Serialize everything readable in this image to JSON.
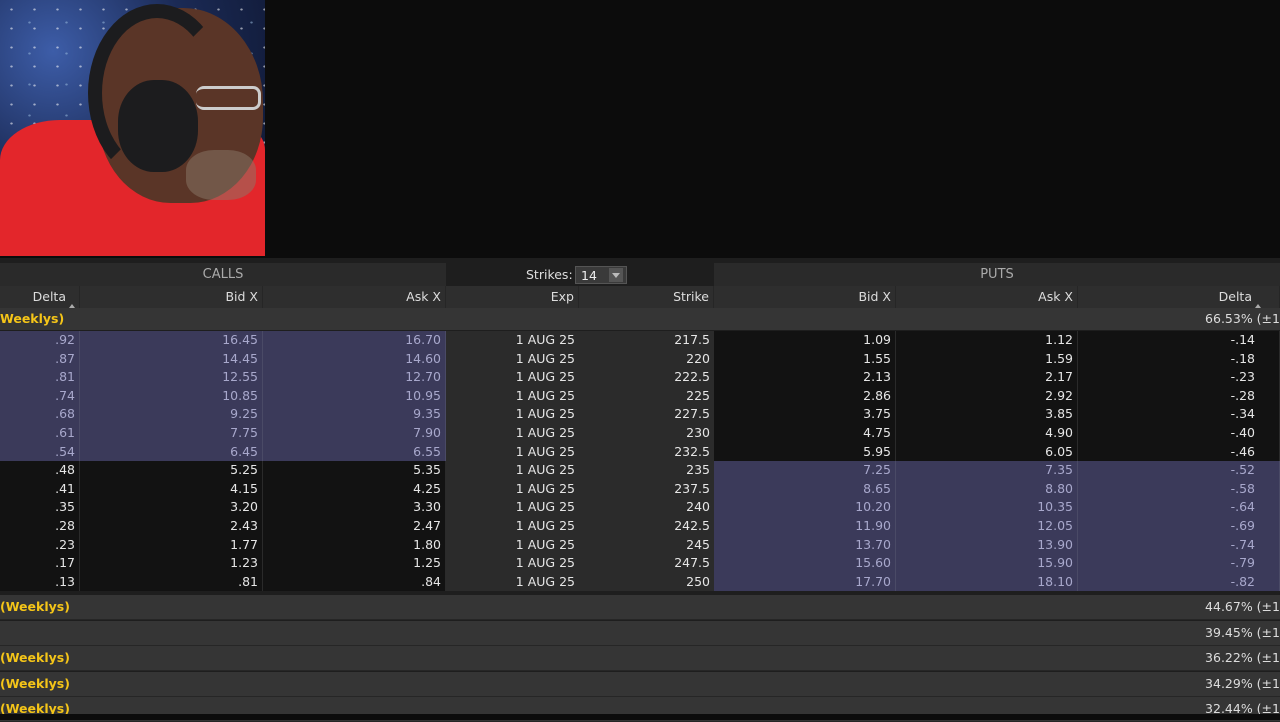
{
  "calls_header": "CALLS",
  "puts_header": "PUTS",
  "strikes_label": "Strikes:",
  "strikes_value": "14",
  "columns": {
    "call_delta": "Delta",
    "call_bid": "Bid X",
    "call_ask": "Ask X",
    "exp": "Exp",
    "strike": "Strike",
    "put_bid": "Bid X",
    "put_ask": "Ask X",
    "put_delta": "Delta"
  },
  "top_group": {
    "name": "Weeklys)",
    "pct": "66.53% (±1"
  },
  "rows": [
    {
      "cd": ".92",
      "cb": "16.45",
      "ca": "16.70",
      "exp": "1 AUG 25",
      "strike": "217.5",
      "pb": "1.09",
      "pa": "1.12",
      "pd": "-.14"
    },
    {
      "cd": ".87",
      "cb": "14.45",
      "ca": "14.60",
      "exp": "1 AUG 25",
      "strike": "220",
      "pb": "1.55",
      "pa": "1.59",
      "pd": "-.18"
    },
    {
      "cd": ".81",
      "cb": "12.55",
      "ca": "12.70",
      "exp": "1 AUG 25",
      "strike": "222.5",
      "pb": "2.13",
      "pa": "2.17",
      "pd": "-.23"
    },
    {
      "cd": ".74",
      "cb": "10.85",
      "ca": "10.95",
      "exp": "1 AUG 25",
      "strike": "225",
      "pb": "2.86",
      "pa": "2.92",
      "pd": "-.28"
    },
    {
      "cd": ".68",
      "cb": "9.25",
      "ca": "9.35",
      "exp": "1 AUG 25",
      "strike": "227.5",
      "pb": "3.75",
      "pa": "3.85",
      "pd": "-.34"
    },
    {
      "cd": ".61",
      "cb": "7.75",
      "ca": "7.90",
      "exp": "1 AUG 25",
      "strike": "230",
      "pb": "4.75",
      "pa": "4.90",
      "pd": "-.40"
    },
    {
      "cd": ".54",
      "cb": "6.45",
      "ca": "6.55",
      "exp": "1 AUG 25",
      "strike": "232.5",
      "pb": "5.95",
      "pa": "6.05",
      "pd": "-.46"
    },
    {
      "cd": ".48",
      "cb": "5.25",
      "ca": "5.35",
      "exp": "1 AUG 25",
      "strike": "235",
      "pb": "7.25",
      "pa": "7.35",
      "pd": "-.52"
    },
    {
      "cd": ".41",
      "cb": "4.15",
      "ca": "4.25",
      "exp": "1 AUG 25",
      "strike": "237.5",
      "pb": "8.65",
      "pa": "8.80",
      "pd": "-.58"
    },
    {
      "cd": ".35",
      "cb": "3.20",
      "ca": "3.30",
      "exp": "1 AUG 25",
      "strike": "240",
      "pb": "10.20",
      "pa": "10.35",
      "pd": "-.64"
    },
    {
      "cd": ".28",
      "cb": "2.43",
      "ca": "2.47",
      "exp": "1 AUG 25",
      "strike": "242.5",
      "pb": "11.90",
      "pa": "12.05",
      "pd": "-.69"
    },
    {
      "cd": ".23",
      "cb": "1.77",
      "ca": "1.80",
      "exp": "1 AUG 25",
      "strike": "245",
      "pb": "13.70",
      "pa": "13.90",
      "pd": "-.74"
    },
    {
      "cd": ".17",
      "cb": "1.23",
      "ca": "1.25",
      "exp": "1 AUG 25",
      "strike": "247.5",
      "pb": "15.60",
      "pa": "15.90",
      "pd": "-.79"
    },
    {
      "cd": ".13",
      "cb": ".81",
      "ca": ".84",
      "exp": "1 AUG 25",
      "strike": "250",
      "pb": "17.70",
      "pa": "18.10",
      "pd": "-.82"
    }
  ],
  "calls_itm_count": 7,
  "bottom_groups": [
    {
      "name": "(Weeklys)",
      "pct": "44.67% (±1"
    },
    {
      "name": "",
      "pct": "39.45% (±1"
    },
    {
      "name": "(Weeklys)",
      "pct": "36.22% (±1"
    },
    {
      "name": "(Weeklys)",
      "pct": "34.29% (±1"
    },
    {
      "name": "(Weeklys)",
      "pct": "32.44% (±1"
    }
  ],
  "colors": {
    "itm": "#3b3a5a",
    "otm": "#121212",
    "weeklys": "#f5c518"
  }
}
